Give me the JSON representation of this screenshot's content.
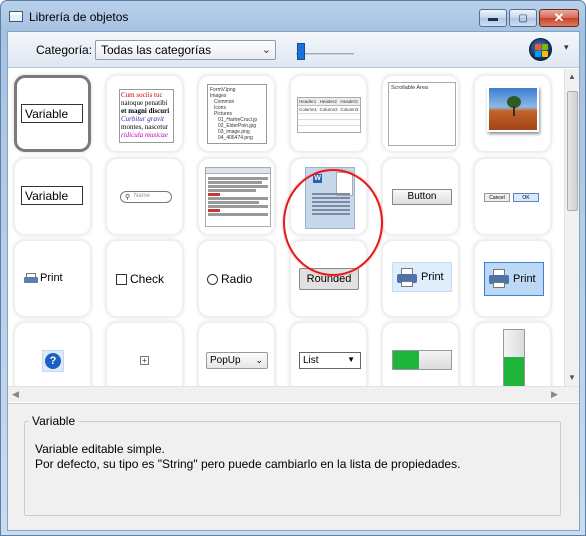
{
  "window": {
    "title": "Librería de objetos",
    "controls": {
      "minimize": "▬",
      "maximize": "▢",
      "close": "✕"
    }
  },
  "toolbar": {
    "category_label": "Categoría:",
    "category_value": "Todas las categorías",
    "menu_arrow": "▾"
  },
  "objects": {
    "variable_label": "Variable",
    "variable_field": "Variable",
    "rich_text": [
      "Cum sociis tuc",
      "natoque penatibi",
      "et magni discuri",
      "Curbitur gravit",
      "montes, nascetur",
      "ridicula musicae"
    ],
    "tree": [
      "FormV.lpng",
      "Images",
      "Common",
      "Icons",
      "Pictures",
      "01_HartreCrucl.jp",
      "02_ElderPoin.jpg",
      "03_image.png",
      "04_406474.png"
    ],
    "table_headers": [
      "Header1",
      "Header2",
      "Header3"
    ],
    "table_cells": [
      "Column1",
      "Column2",
      "Column3"
    ],
    "scroll_area": "Scrollable Area",
    "search_placeholder": "Name",
    "word_label": "W",
    "button_label": "Button",
    "cancel_label": "Cancel",
    "ok_label": "OK",
    "print_label": "Print",
    "check_label": "Check",
    "radio_label": "Radio",
    "rounded_label": "Rounded",
    "help_glyph": "?",
    "plus_glyph": "+",
    "popup_label": "PopUp",
    "list_label": "List",
    "progress_horizontal": 0.45,
    "progress_vertical": 0.55
  },
  "description": {
    "title": "Variable",
    "line1": "Variable editable simple.",
    "line2": "Por defecto, su tipo es \"String\" pero puede cambiarlo en la lista de propiedades."
  },
  "colors": {
    "accent": "#1b72d6",
    "highlight_circle": "#e21b1b",
    "progress_green": "#1eb53a"
  }
}
